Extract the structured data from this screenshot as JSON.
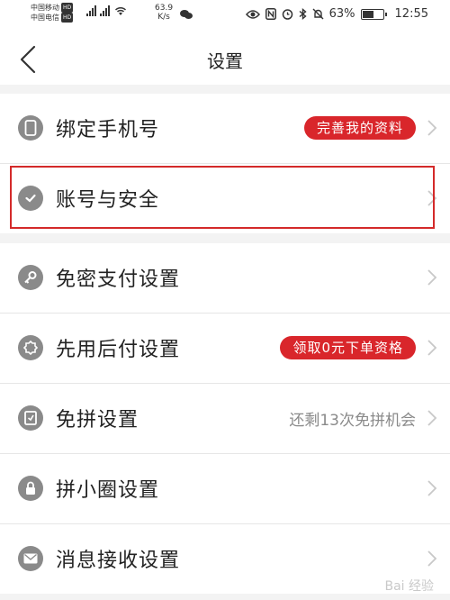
{
  "status_bar": {
    "carrier1": "中国移动",
    "carrier2": "中国电信",
    "hd": "HD",
    "net_speed_value": "63.9",
    "net_speed_unit": "K/s",
    "battery": "63%",
    "time": "12:55"
  },
  "header": {
    "title": "设置"
  },
  "section1": [
    {
      "label": "绑定手机号",
      "icon": "phone-icon",
      "pill": "完善我的资料"
    },
    {
      "label": "账号与安全",
      "icon": "shield-check-icon"
    }
  ],
  "section2": [
    {
      "label": "免密支付设置",
      "icon": "key-icon"
    },
    {
      "label": "先用后付设置",
      "icon": "badge-icon",
      "pill": "领取0元下单资格"
    },
    {
      "label": "免拼设置",
      "icon": "ticket-icon",
      "side_text": "还剩13次免拼机会"
    },
    {
      "label": "拼小圈设置",
      "icon": "lock-icon"
    },
    {
      "label": "消息接收设置",
      "icon": "message-icon"
    }
  ],
  "watermark": "Bai 经验",
  "colors": {
    "accent": "#d9262b",
    "icon_gray": "#8a8a8a"
  },
  "battery_level": 0.63
}
